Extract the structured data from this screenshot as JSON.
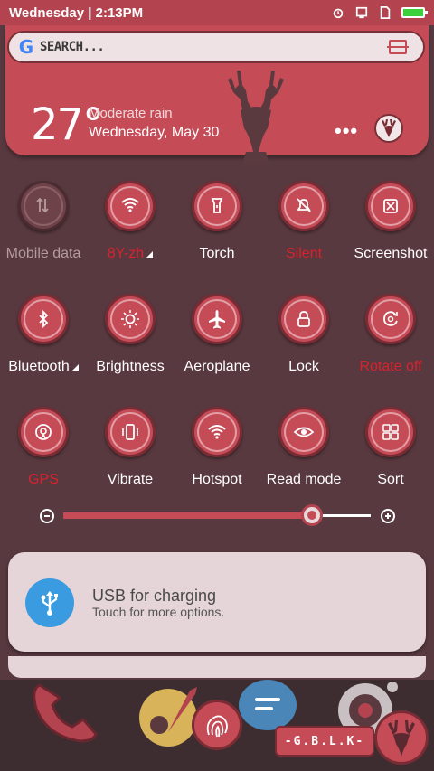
{
  "status_bar": {
    "time_label": "Wednesday | 2:13PM",
    "icons": [
      "alarm-icon",
      "screen-icon",
      "sim-icon",
      "battery-icon"
    ],
    "battery_color": "#3cd03c"
  },
  "search": {
    "logo": "G",
    "placeholder": "SEARCH..."
  },
  "weather": {
    "temperature": "27°",
    "condition": "Moderate rain",
    "date": "Wednesday, May 30",
    "more": "•••"
  },
  "toggles": [
    {
      "label": "Mobile data",
      "icon": "mobile-data-icon",
      "state": "off"
    },
    {
      "label": "8Y-zh",
      "icon": "wifi-icon",
      "state": "on"
    },
    {
      "label": "Torch",
      "icon": "torch-icon",
      "state": "off"
    },
    {
      "label": "Silent",
      "icon": "silent-icon",
      "state": "on"
    },
    {
      "label": "Screenshot",
      "icon": "screenshot-icon",
      "state": "off"
    },
    {
      "label": "Bluetooth",
      "icon": "bluetooth-icon",
      "state": "off"
    },
    {
      "label": "Brightness",
      "icon": "brightness-icon",
      "state": "off"
    },
    {
      "label": "Aeroplane",
      "icon": "aeroplane-icon",
      "state": "off"
    },
    {
      "label": "Lock",
      "icon": "lock-icon",
      "state": "off"
    },
    {
      "label": "Rotate off",
      "icon": "rotate-icon",
      "state": "on"
    },
    {
      "label": "GPS",
      "icon": "gps-icon",
      "state": "on"
    },
    {
      "label": "Vibrate",
      "icon": "vibrate-icon",
      "state": "off"
    },
    {
      "label": "Hotspot",
      "icon": "hotspot-icon",
      "state": "off"
    },
    {
      "label": "Read mode",
      "icon": "read-mode-icon",
      "state": "off"
    },
    {
      "label": "Sort",
      "icon": "sort-icon",
      "state": "off"
    }
  ],
  "brightness": {
    "level": 0.81
  },
  "notification": {
    "title": "USB for charging",
    "subtitle": "Touch for more options.",
    "icon": "usb-icon"
  },
  "dock": {
    "badge_text": "-G.B.L.K-",
    "apps": [
      "phone-icon",
      "rocket-icon",
      "fingerprint-icon",
      "messages-icon",
      "camera-icon"
    ]
  },
  "colors": {
    "accent": "#c54b57",
    "background": "#58393f",
    "active_label": "#d8232e"
  }
}
